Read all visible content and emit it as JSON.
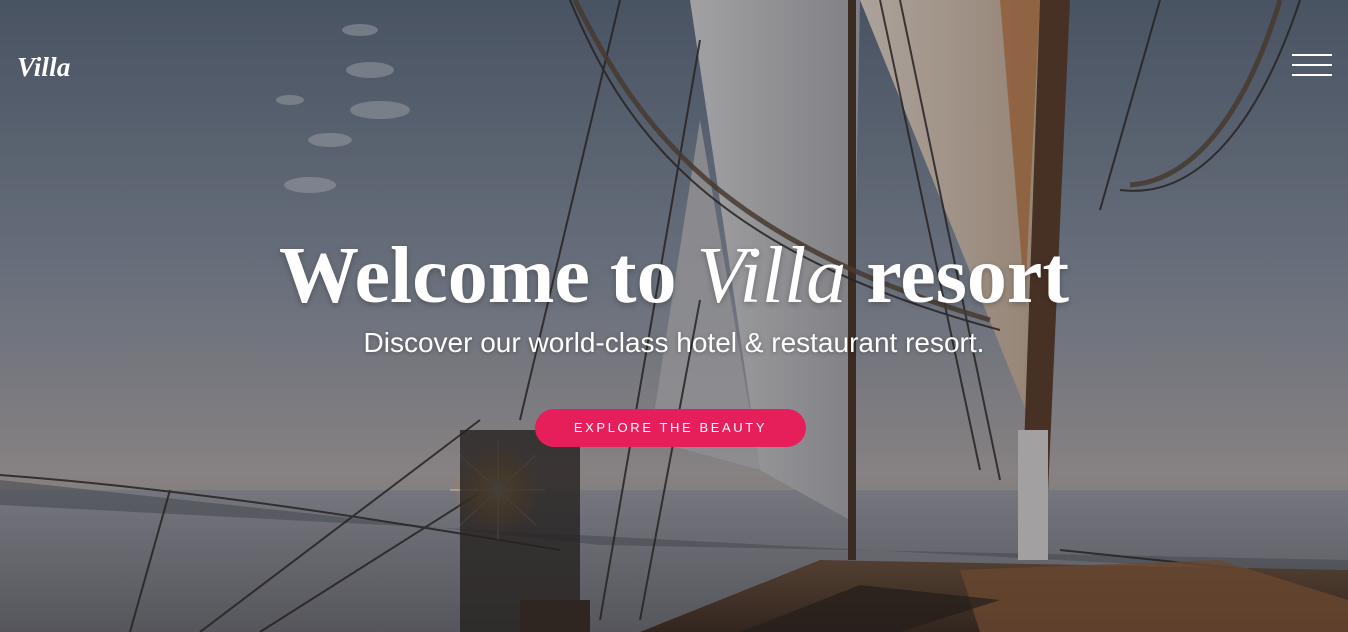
{
  "header": {
    "logo": "Villa"
  },
  "hero": {
    "title_prefix": "Welcome to",
    "title_accent": "Villa",
    "title_suffix": "resort",
    "subtitle": "Discover our world-class hotel & restaurant resort.",
    "cta_label": "EXPLORE THE BEAUTY"
  },
  "colors": {
    "accent": "#e61e5a",
    "text": "#ffffff"
  },
  "icons": {
    "menu": "hamburger-menu-icon"
  }
}
